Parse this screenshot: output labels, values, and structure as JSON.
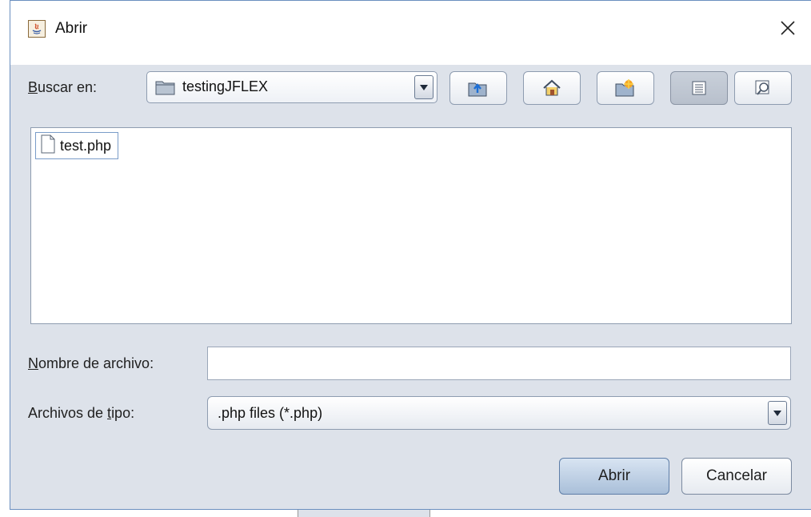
{
  "window": {
    "title": "Abrir",
    "close_icon": "close-icon",
    "app_icon": "java-icon"
  },
  "look_in": {
    "label_underlined": "B",
    "label_rest": "uscar en:",
    "value": "testingJFLEX",
    "icon": "folder-icon"
  },
  "toolbar": {
    "buttons": [
      {
        "name": "up-one-level",
        "icon": "folder-up-icon"
      },
      {
        "name": "home",
        "icon": "home-icon"
      },
      {
        "name": "new-folder",
        "icon": "new-folder-icon"
      },
      {
        "name": "list-view",
        "icon": "list-view-icon",
        "active": true
      },
      {
        "name": "details-view",
        "icon": "details-view-icon",
        "active": false
      }
    ]
  },
  "files": [
    {
      "name": "test.php",
      "icon": "file-icon"
    }
  ],
  "filename": {
    "label_underlined": "N",
    "label_rest": "ombre de archivo:",
    "value": "",
    "placeholder": ""
  },
  "file_type": {
    "label_pre": "Archivos de ",
    "label_underlined": "t",
    "label_post": "ipo:",
    "value": ".php files (*.php)"
  },
  "actions": {
    "open_label": "Abrir",
    "cancel_label": "Cancelar"
  },
  "colors": {
    "background": "#dde2ea",
    "accent_button": "#a9bfd9",
    "border": "#8e9cb0"
  }
}
